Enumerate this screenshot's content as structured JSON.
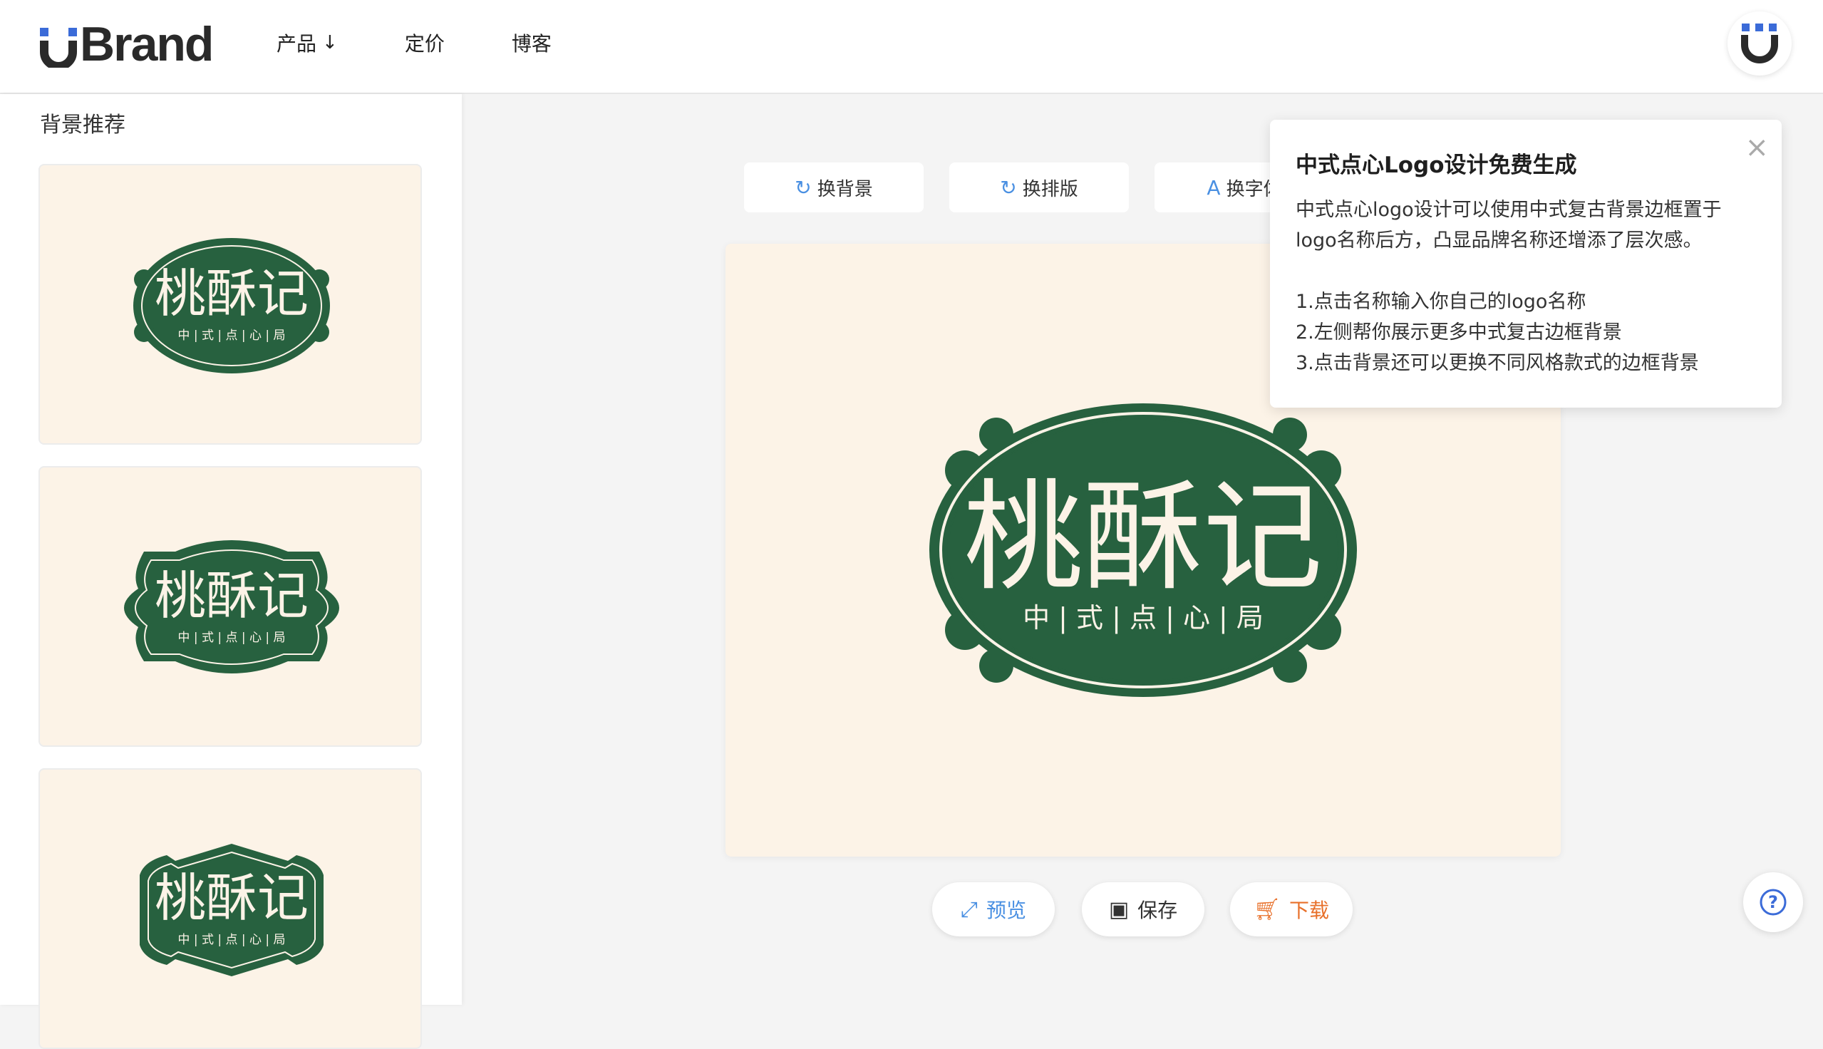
{
  "header": {
    "brand": "Brand",
    "nav": [
      {
        "label": "产品",
        "has_dropdown": true
      },
      {
        "label": "定价"
      },
      {
        "label": "博客"
      }
    ]
  },
  "sidebar": {
    "title": "背景推荐"
  },
  "logo_design": {
    "name": "桃酥记",
    "tagline": "中 | 式 | 点 | 心 | 局",
    "colors": {
      "badge": "#27613f",
      "cream": "#fcf3e7",
      "text": "#fcf3e7"
    }
  },
  "toolbar": {
    "change_background": "换背景",
    "change_layout": "换排版",
    "change_font": "换字体"
  },
  "actions": {
    "preview": "预览",
    "save": "保存",
    "download": "下载"
  },
  "tip": {
    "title": "中式点心Logo设计免费生成",
    "intro": "中式点心logo设计可以使用中式复古背景边框置于logo名称后方，凸显品牌名称还增添了层次感。",
    "steps": [
      "1.点击名称输入你自己的logo名称",
      "2.左侧帮你展示更多中式复古边框背景",
      "3.点击背景还可以更换不同风格款式的边框背景"
    ],
    "close_icon": "close-icon"
  },
  "colors": {
    "accent_blue": "#4a90e2",
    "download_orange": "#e8702a",
    "brand_dark": "#2a2a2a"
  }
}
